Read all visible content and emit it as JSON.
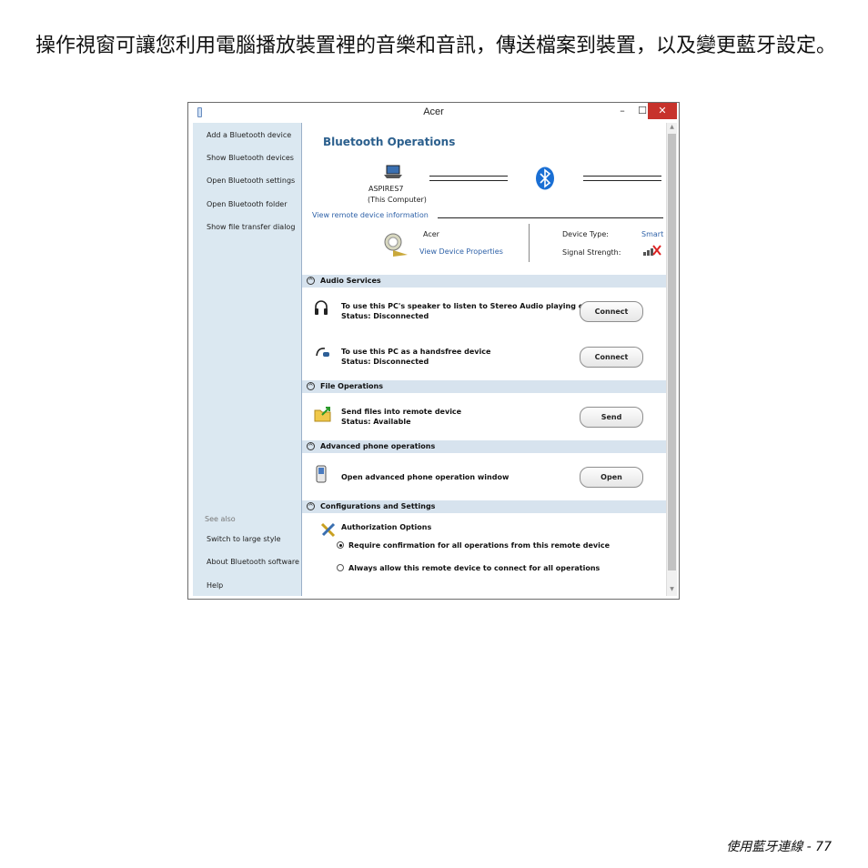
{
  "intro_text": "操作視窗可讓您利用電腦播放裝置裡的音樂和音訊，傳送檔案到裝置，以及變更藍牙設定。",
  "footer": "使用藍牙連線 -  77",
  "window": {
    "title": "Acer",
    "controls": {
      "minimize": "–",
      "maximize": "☐",
      "close": "✕"
    }
  },
  "sidebar": {
    "items": [
      "Add a Bluetooth device",
      "Show Bluetooth devices",
      "Open Bluetooth settings",
      "Open Bluetooth folder",
      "Show file transfer dialog"
    ],
    "see_also_label": "See also",
    "see_also": [
      "Switch to large style",
      "About Bluetooth software",
      "Help"
    ]
  },
  "main": {
    "heading": "Bluetooth Operations",
    "computer_name": "ASPIRES7",
    "computer_sub": "(This Computer)",
    "remote_info_link": "View remote device information",
    "device_name": "Acer",
    "device_props_link": "View Device Properties",
    "device_type_label": "Device Type:",
    "device_type_value": "Smart",
    "signal_label": "Signal Strength:"
  },
  "sections": {
    "audio": {
      "title": "Audio Services",
      "rows": [
        {
          "line1": "To use this PC's speaker to listen to Stereo Audio playing on",
          "line2": "Status:   Disconnected",
          "button": "Connect"
        },
        {
          "line1": "To use this PC as a handsfree device",
          "line2": "Status:   Disconnected",
          "button": "Connect"
        }
      ]
    },
    "file": {
      "title": "File Operations",
      "row": {
        "line1": "Send files into remote device",
        "line2": "Status:   Available",
        "button": "Send"
      }
    },
    "phone": {
      "title": "Advanced phone operations",
      "row": {
        "line1": "Open advanced phone operation window",
        "button": "Open"
      }
    },
    "config": {
      "title": "Configurations and Settings",
      "auth_label": "Authorization Options",
      "option1": "Require confirmation for all operations from this remote device",
      "option2": "Always allow this remote device to connect for all operations",
      "selected_option": 1
    }
  },
  "colors": {
    "accent": "#2b5f8d",
    "sidebar_bg": "#dbe8f1",
    "section_bg": "#d7e3ee",
    "close_btn": "#c7332c"
  }
}
